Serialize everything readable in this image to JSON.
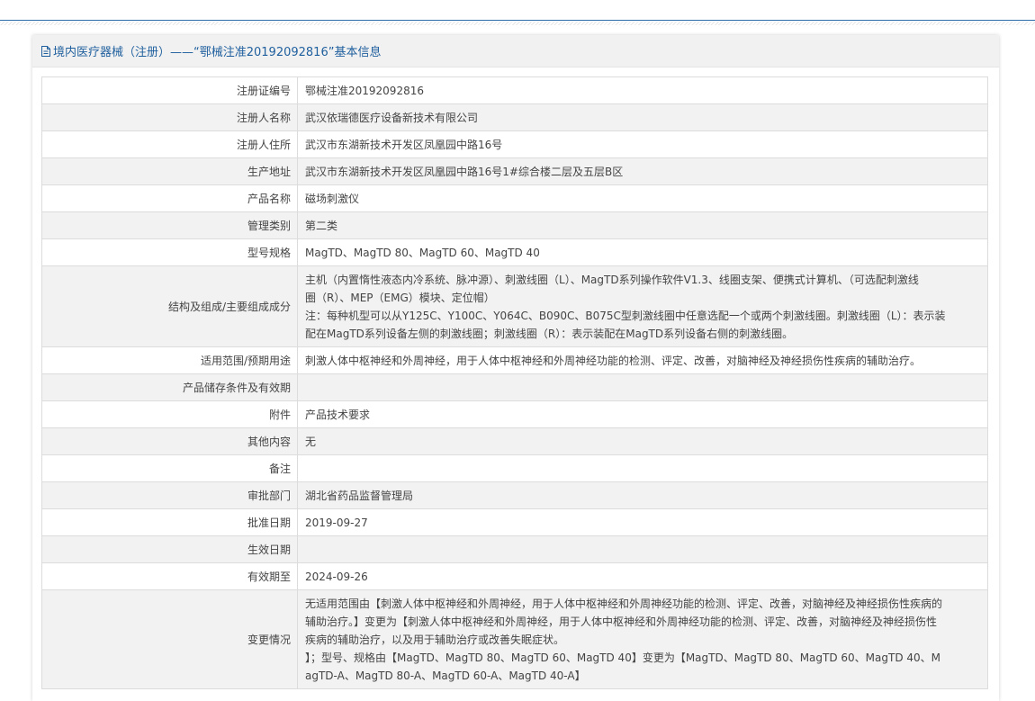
{
  "header": {
    "title": "境内医疗器械（注册）——“鄂械注准20192092816”基本信息",
    "icon": "document-icon"
  },
  "rows": [
    {
      "label": "注册证编号",
      "value": "鄂械注准20192092816"
    },
    {
      "label": "注册人名称",
      "value": "武汉依瑞德医疗设备新技术有限公司"
    },
    {
      "label": "注册人住所",
      "value": "武汉市东湖新技术开发区凤凰园中路16号"
    },
    {
      "label": "生产地址",
      "value": "武汉市东湖新技术开发区凤凰园中路16号1#综合楼二层及五层B区"
    },
    {
      "label": "产品名称",
      "value": "磁场刺激仪"
    },
    {
      "label": "管理类别",
      "value": "第二类"
    },
    {
      "label": "型号规格",
      "value": "MagTD、MagTD 80、MagTD 60、MagTD 40"
    },
    {
      "label": "结构及组成/主要组成成分",
      "lines": [
        "主机（内置惰性液态内冷系统、脉冲源）、刺激线圈（L）、MagTD系列操作软件V1.3、线圈支架、便携式计算机、（可选配刺激线",
        "圈（R）、MEP（EMG）模块、定位帽）",
        "注：每种机型可以从Y125C、Y100C、Y064C、B090C、B075C型刺激线圈中任意选配一个或两个刺激线圈。刺激线圈（L）：表示装",
        "配在MagTD系列设备左侧的刺激线圈；刺激线圈（R）：表示装配在MagTD系列设备右侧的刺激线圈。"
      ]
    },
    {
      "label": "适用范围/预期用途",
      "value": "刺激人体中枢神经和外周神经，用于人体中枢神经和外周神经功能的检测、评定、改善，对脑神经及神经损伤性疾病的辅助治疗。"
    },
    {
      "label": "产品储存条件及有效期",
      "value": ""
    },
    {
      "label": "附件",
      "value": "产品技术要求"
    },
    {
      "label": "其他内容",
      "value": "无"
    },
    {
      "label": "备注",
      "value": ""
    },
    {
      "label": "审批部门",
      "value": "湖北省药品监督管理局"
    },
    {
      "label": "批准日期",
      "value": "2019-09-27"
    },
    {
      "label": "生效日期",
      "value": ""
    },
    {
      "label": "有效期至",
      "value": "2024-09-26"
    },
    {
      "label": "变更情况",
      "lines": [
        "无适用范围由【刺激人体中枢神经和外周神经，用于人体中枢神经和外周神经功能的检测、评定、改善，对脑神经及神经损伤性疾病的",
        "辅助治疗。】变更为【刺激人体中枢神经和外周神经，用于人体中枢神经和外周神经功能的检测、评定、改善，对脑神经及神经损伤性",
        "疾病的辅助治疗，以及用于辅助治疗或改善失眠症状。",
        "】；型号、规格由【MagTD、MagTD 80、MagTD 60、MagTD 40】变更为【MagTD、MagTD 80、MagTD 60、MagTD 40、M",
        "agTD-A、MagTD 80-A、MagTD 60-A、MagTD 40-A】"
      ]
    }
  ]
}
